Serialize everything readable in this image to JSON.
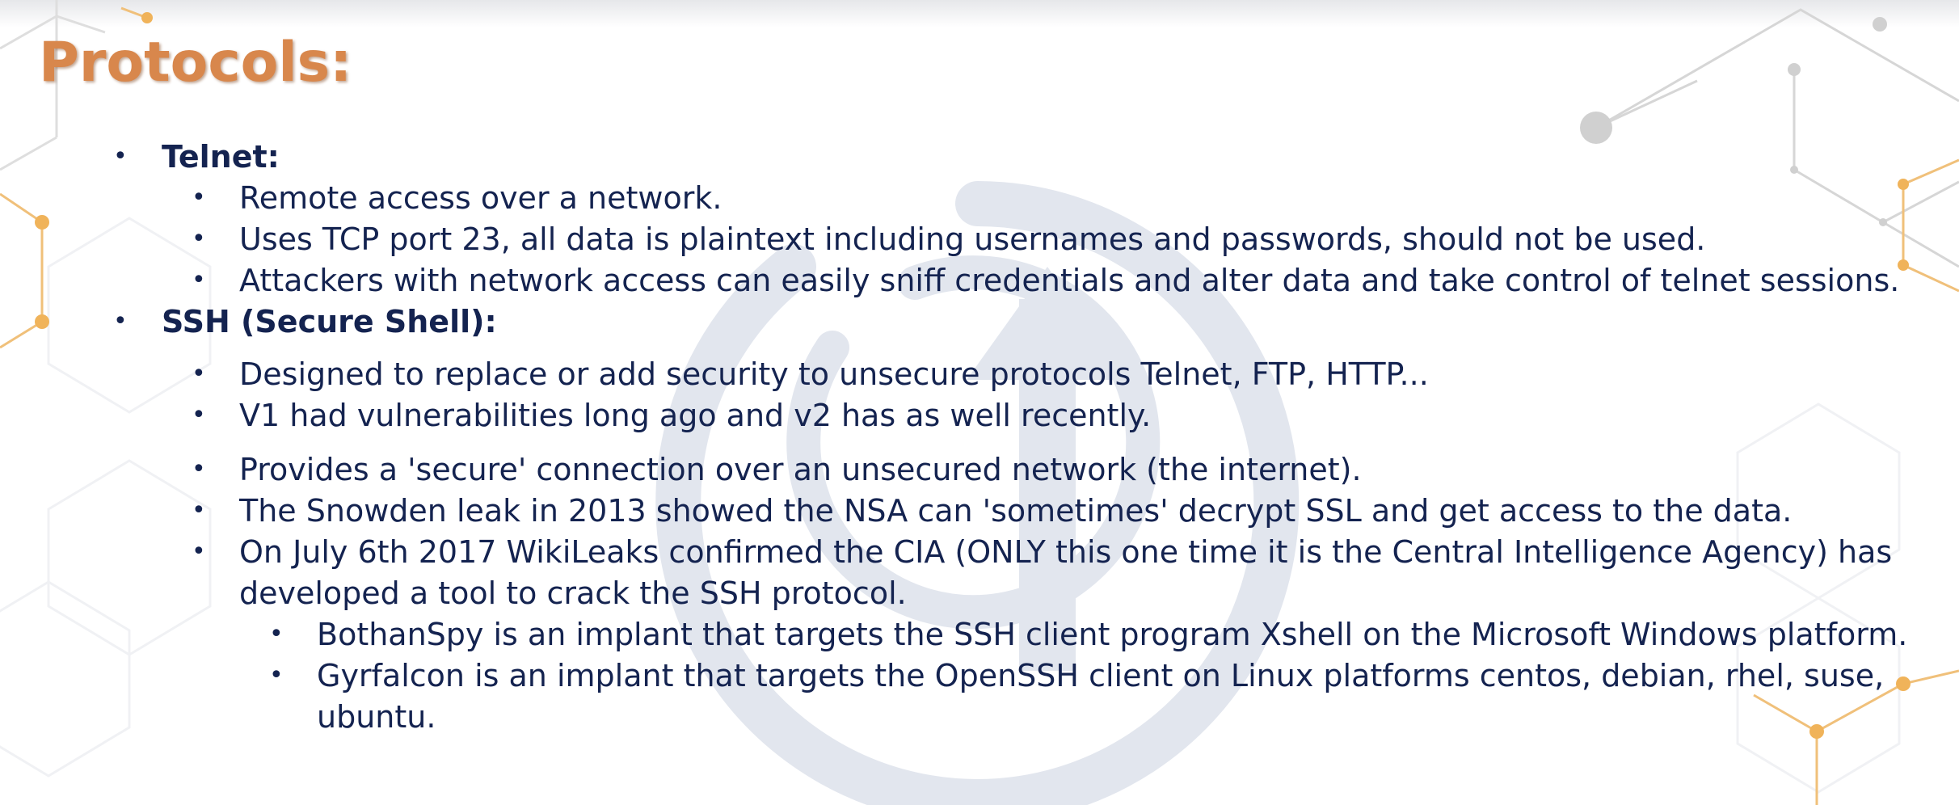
{
  "slide": {
    "title": "Protocols:"
  },
  "telnet": {
    "heading": "Telnet:",
    "points": [
      "Remote access over a network.",
      "Uses TCP port 23, all data is plaintext including usernames and passwords, should not be used.",
      "Attackers with network access can easily sniff credentials and alter data and take control of telnet sessions."
    ]
  },
  "ssh": {
    "heading": "SSH (Secure Shell):",
    "points": [
      "Designed to replace or add security to unsecure protocols Telnet, FTP, HTTP...",
      "V1 had vulnerabilities long ago and v2 has as well recently.",
      "Provides a 'secure' connection over an unsecured network (the internet).",
      "The Snowden leak in 2013 showed the NSA can 'sometimes' decrypt SSL and get access to the data."
    ],
    "wikileaks": {
      "line1": "On July 6th 2017 WikiLeaks confirmed the CIA (ONLY this one time it is the Central Intelligence Agency) has",
      "line2": "developed a tool to crack the SSH protocol.",
      "subpoints": {
        "bothanspy": "BothanSpy is an implant that targets the SSH client program Xshell on the Microsoft Windows platform.",
        "gyrfalcon_line1": "Gyrfalcon is an implant that targets the OpenSSH client on Linux platforms centos, debian, rhel, suse,",
        "gyrfalcon_line2": "ubuntu."
      }
    }
  },
  "bullet_glyph": "•",
  "colors": {
    "title": "#d8874c",
    "text": "#142350",
    "watermark": "#dfe3ec",
    "network_lines": "#d9d9d9",
    "network_nodes_accent": "#f0b35a"
  }
}
